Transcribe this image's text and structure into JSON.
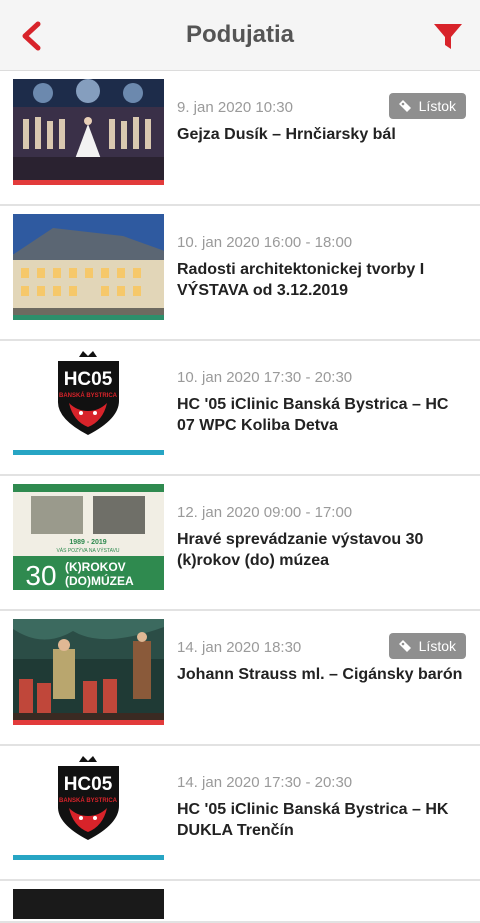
{
  "header": {
    "title": "Podujatia"
  },
  "events": [
    {
      "date": "9. jan 2020 10:30",
      "title": "Gejza Dusík – Hrnčiarsky bál",
      "ticket": "Lístok",
      "bar_color": "#e23b3b",
      "thumb": "stage-ballet-image"
    },
    {
      "date": "10. jan 2020 16:00 - 18:00",
      "title": "Radosti architektonickej tvorby I VÝSTAVA od 3.12.2019",
      "bar_color": "#2c8f6b",
      "thumb": "historic-building-image"
    },
    {
      "date": "10. jan 2020 17:30 - 20:30",
      "title": "HC '05 iClinic Banská Bystrica – HC 07 WPC Koliba Detva",
      "bar_color": "#27a5c4",
      "thumb": "hc05-logo"
    },
    {
      "date": "12. jan 2020 09:00 - 17:00",
      "title": "Hravé sprevádzanie výstavou 30 (k)rokov (do) múzea",
      "bar_color": "#2c8f6b",
      "thumb": "museum-poster-image",
      "poster": {
        "years": "1989 - 2019",
        "invite": "VÁS POZÝVA NA VÝSTAVU",
        "big_number": "30",
        "line1": "(K)ROKOV",
        "line2": "(DO)MÚZEA"
      }
    },
    {
      "date": "14. jan 2020 18:30",
      "title": "Johann Strauss ml. – Cigánsky barón",
      "ticket": "Lístok",
      "bar_color": "#e23b3b",
      "thumb": "opera-scene-image"
    },
    {
      "date": "14. jan 2020 17:30 - 20:30",
      "title": "HC '05 iClinic Banská Bystrica – HK DUKLA Trenčín",
      "bar_color": "#27a5c4",
      "thumb": "hc05-logo"
    }
  ],
  "logo": {
    "text": "HC05",
    "subtext": "BANSKÁ BYSTRICA"
  },
  "colors": {
    "accent": "#d8232a",
    "ticket_bg": "#8f8f8f"
  }
}
